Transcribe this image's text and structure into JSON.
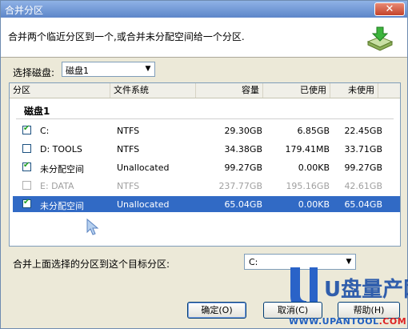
{
  "window": {
    "title": "合并分区",
    "close_label": "✕"
  },
  "header": {
    "description": "合并两个临近分区到一个,或合并未分配空间给一个分区."
  },
  "disk_picker": {
    "label": "选择磁盘:",
    "value": "磁盘1"
  },
  "table": {
    "columns": [
      "分区",
      "文件系统",
      "容量",
      "已使用",
      "未使用"
    ],
    "group": "磁盘1",
    "rows": [
      {
        "name": "C:",
        "fs": "NTFS",
        "capacity": "29.30GB",
        "used": "6.85GB",
        "free": "22.45GB",
        "checked": true,
        "disabled": false,
        "selected": false
      },
      {
        "name": "D:  TOOLS",
        "fs": "NTFS",
        "capacity": "34.38GB",
        "used": "179.41MB",
        "free": "33.71GB",
        "checked": false,
        "disabled": false,
        "selected": false
      },
      {
        "name": "未分配空间",
        "fs": "Unallocated",
        "capacity": "99.27GB",
        "used": "0.00KB",
        "free": "99.27GB",
        "checked": true,
        "disabled": false,
        "selected": false
      },
      {
        "name": "E:  DATA",
        "fs": "NTFS",
        "capacity": "237.77GB",
        "used": "195.16GB",
        "free": "42.61GB",
        "checked": false,
        "disabled": true,
        "selected": false
      },
      {
        "name": "未分配空间",
        "fs": "Unallocated",
        "capacity": "65.04GB",
        "used": "0.00KB",
        "free": "65.04GB",
        "checked": true,
        "disabled": false,
        "selected": true
      }
    ]
  },
  "merge_target": {
    "label": "合并上面选择的分区到这个目标分区:",
    "value": "C:"
  },
  "buttons": {
    "ok": "确定(O)",
    "cancel": "取消(C)",
    "help": "帮助(H)"
  },
  "watermark": {
    "brand": "U盘量产网",
    "url_main": "WWW.UPANTOOL",
    "url_suffix": ".COM"
  },
  "icons": {
    "header_icon": "merge-partition-icon",
    "dropdown": "chevron-down-icon",
    "checkbox": "checkmark-icon",
    "cursor": "mouse-pointer-icon"
  },
  "colors": {
    "selection": "#316ac5",
    "titlebar": "#5d86c9",
    "check": "#21a121"
  }
}
